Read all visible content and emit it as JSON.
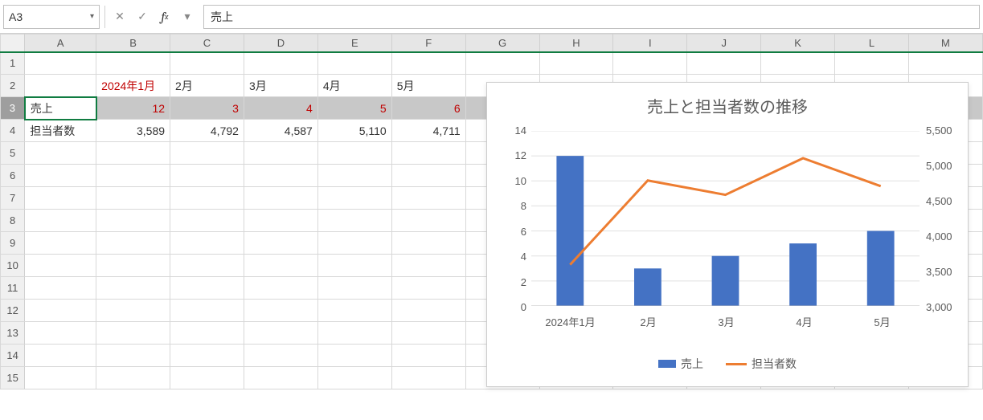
{
  "namebox": "A3",
  "formula_value": "売上",
  "columns": [
    "A",
    "B",
    "C",
    "D",
    "E",
    "F",
    "G",
    "H",
    "I",
    "J",
    "K",
    "L",
    "M"
  ],
  "rows_visible": 15,
  "table": {
    "headers_row2": [
      "",
      "2024年1月",
      "2月",
      "3月",
      "4月",
      "5月"
    ],
    "row3_label": "売上",
    "row3_values": [
      "12",
      "3",
      "4",
      "5",
      "6"
    ],
    "row4_label": "担当者数",
    "row4_values": [
      "3,589",
      "4,792",
      "4,587",
      "5,110",
      "4,711"
    ]
  },
  "chart_data": {
    "type": "bar+line",
    "title": "売上と担当者数の推移",
    "categories": [
      "2024年1月",
      "2月",
      "3月",
      "4月",
      "5月"
    ],
    "series": [
      {
        "name": "売上",
        "type": "bar",
        "axis": "left",
        "values": [
          12,
          3,
          4,
          5,
          6
        ]
      },
      {
        "name": "担当者数",
        "type": "line",
        "axis": "right",
        "values": [
          3589,
          4792,
          4587,
          5110,
          4711
        ]
      }
    ],
    "y_left": {
      "min": 0,
      "max": 14,
      "ticks": [
        0,
        2,
        4,
        6,
        8,
        10,
        12,
        14
      ]
    },
    "y_right": {
      "min": 3000,
      "max": 5500,
      "ticks": [
        3000,
        3500,
        4000,
        4500,
        5000,
        5500
      ]
    },
    "legend": [
      "売上",
      "担当者数"
    ],
    "colors": {
      "bar": "#4472c4",
      "line": "#ed7d31"
    }
  }
}
